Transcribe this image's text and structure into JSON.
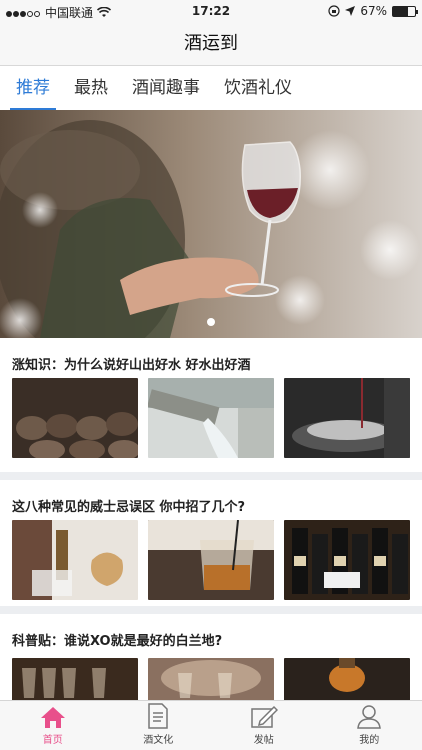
{
  "status": {
    "carrier": "中国联通",
    "time": "17:22",
    "battery": "67%",
    "battery_level": 0.67
  },
  "nav": {
    "title": "酒运到"
  },
  "tabs": [
    {
      "label": "推荐",
      "active": true
    },
    {
      "label": "最热",
      "active": false
    },
    {
      "label": "酒闻趣事",
      "active": false
    },
    {
      "label": "饮酒礼仪",
      "active": false
    }
  ],
  "articles": [
    {
      "title": "涨知识：为什么说好山出好水 好水出好酒"
    },
    {
      "title": "这八种常见的威士忌误区 你中招了几个?"
    },
    {
      "title": "科普贴：谁说XO就是最好的白兰地?"
    }
  ],
  "tabbar": [
    {
      "label": "首页",
      "icon": "home-icon",
      "active": true
    },
    {
      "label": "酒文化",
      "icon": "document-icon",
      "active": false
    },
    {
      "label": "发帖",
      "icon": "compose-icon",
      "active": false
    },
    {
      "label": "我的",
      "icon": "person-icon",
      "active": false
    }
  ],
  "colors": {
    "accent": "#2e7bd6",
    "tab_active": "#e8508b"
  }
}
